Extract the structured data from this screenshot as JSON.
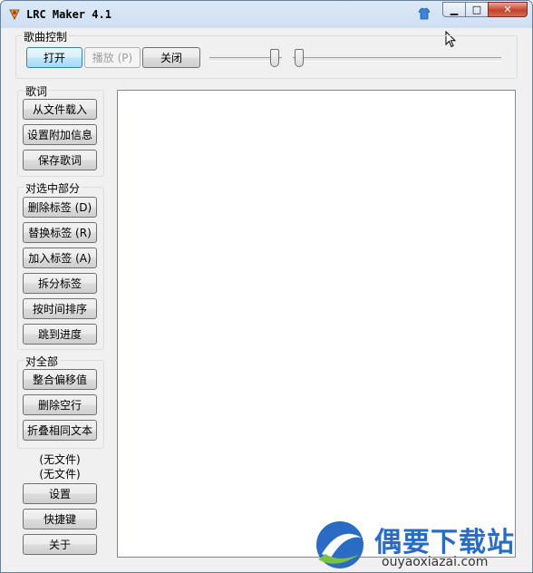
{
  "window": {
    "title": "LRC Maker 4.1"
  },
  "song_control": {
    "label": "歌曲控制",
    "open_button": "打开",
    "play_button": "播放 (P)",
    "close_button": "关闭"
  },
  "lyrics_group": {
    "label": "歌词",
    "buttons": [
      "从文件载入",
      "设置附加信息",
      "保存歌词"
    ]
  },
  "selection_group": {
    "label": "对选中部分",
    "buttons": [
      "删除标签 (D)",
      "替换标签 (R)",
      "加入标签 (A)",
      "拆分标签",
      "按时间排序",
      "跳到进度"
    ]
  },
  "all_group": {
    "label": "对全部",
    "buttons": [
      "整合偏移值",
      "删除空行",
      "折叠相同文本"
    ]
  },
  "status": {
    "line1": "(无文件)",
    "line2": "(无文件)"
  },
  "bottom_buttons": [
    "设置",
    "快捷键",
    "关于"
  ],
  "watermark": {
    "title": "偶要下载站",
    "subtitle": "ouyaoxiazai.com"
  },
  "colors": {
    "accent": "#2a6cc4",
    "close": "#c4412c"
  },
  "sliders": {
    "position": 0.35,
    "volume": 0.0
  }
}
